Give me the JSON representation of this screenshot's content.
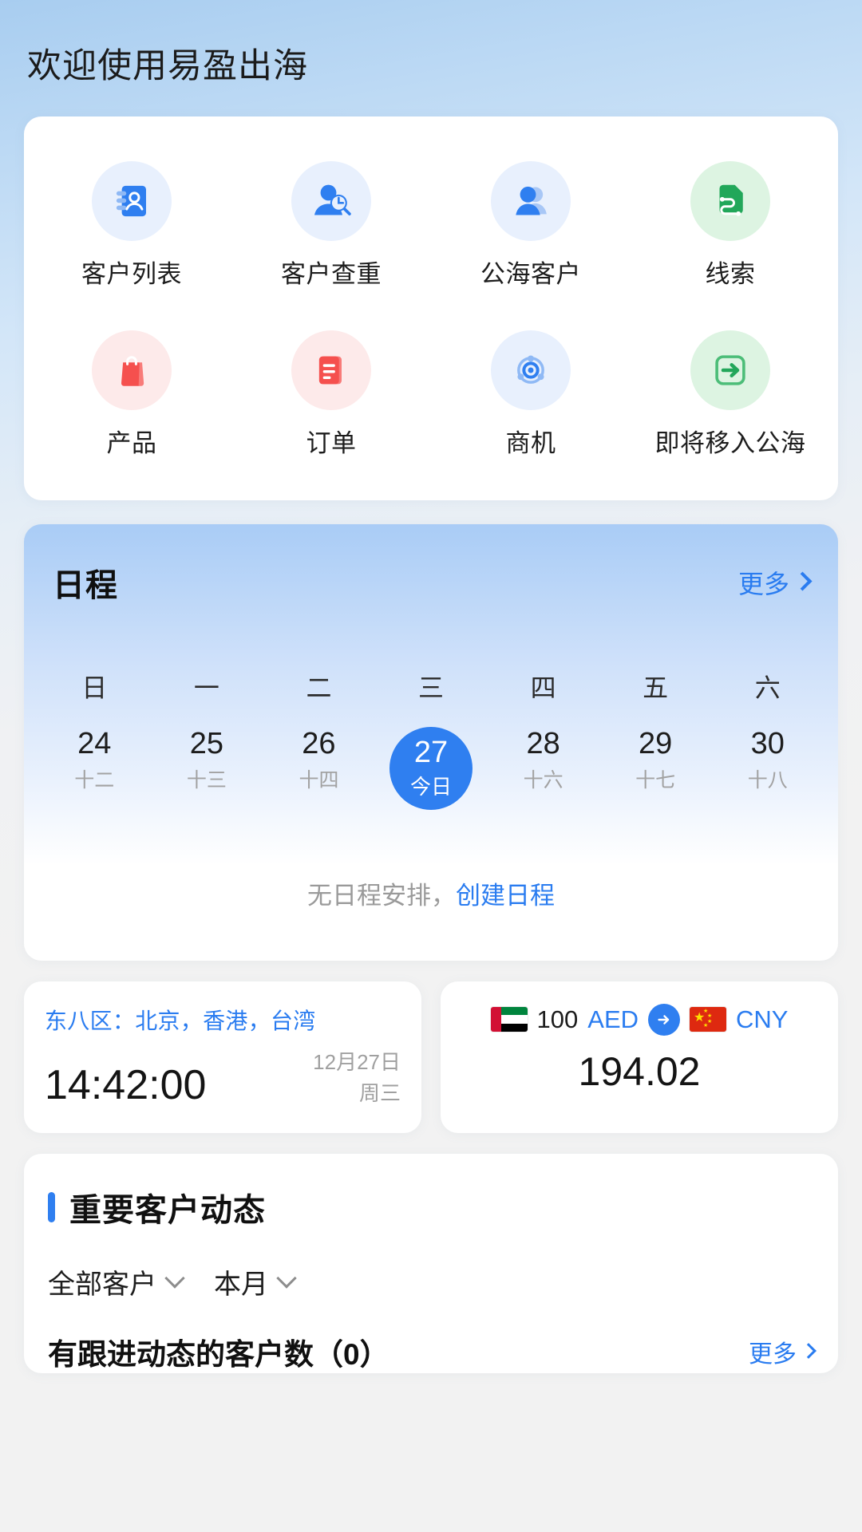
{
  "header": {
    "title": "欢迎使用易盈出海"
  },
  "quicknav": {
    "items": [
      {
        "label": "客户列表",
        "icon": "contact-book-icon",
        "tone": "blue"
      },
      {
        "label": "客户查重",
        "icon": "person-search-icon",
        "tone": "blue"
      },
      {
        "label": "公海客户",
        "icon": "people-group-icon",
        "tone": "blue"
      },
      {
        "label": "线索",
        "icon": "lead-route-icon",
        "tone": "green"
      },
      {
        "label": "产品",
        "icon": "shopping-bag-icon",
        "tone": "red"
      },
      {
        "label": "订单",
        "icon": "order-document-icon",
        "tone": "red"
      },
      {
        "label": "商机",
        "icon": "opportunity-target-icon",
        "tone": "blue"
      },
      {
        "label": "即将移入公海",
        "icon": "arrow-right-box-icon",
        "tone": "green"
      }
    ]
  },
  "schedule": {
    "title": "日程",
    "more_label": "更多",
    "weekdays": [
      "日",
      "一",
      "二",
      "三",
      "四",
      "五",
      "六"
    ],
    "days": [
      {
        "num": "24",
        "lunar": "十二",
        "today": false
      },
      {
        "num": "25",
        "lunar": "十三",
        "today": false
      },
      {
        "num": "26",
        "lunar": "十四",
        "today": false
      },
      {
        "num": "27",
        "lunar": "今日",
        "today": true
      },
      {
        "num": "28",
        "lunar": "十六",
        "today": false
      },
      {
        "num": "29",
        "lunar": "十七",
        "today": false
      },
      {
        "num": "30",
        "lunar": "十八",
        "today": false
      }
    ],
    "empty_text": "无日程安排，",
    "create_label": "创建日程"
  },
  "timezone_card": {
    "label": "东八区：北京，香港，台湾",
    "time": "14:42:00",
    "date": "12月27日",
    "weekday": "周三"
  },
  "currency_card": {
    "from_flag": "ae-flag-icon",
    "from_amount": "100",
    "from_currency": "AED",
    "arrow": "arrow-right-icon",
    "to_flag": "cn-flag-icon",
    "to_currency": "CNY",
    "rate": "194.02"
  },
  "customer_section": {
    "title": "重要客户动态",
    "filters": [
      {
        "label": "全部客户"
      },
      {
        "label": "本月"
      }
    ],
    "stat_label": "有跟进动态的客户数（0）",
    "stat_more": "更多"
  },
  "colors": {
    "accent": "#2f7ff0",
    "link": "#2a7cf0",
    "green": "#2aab5a",
    "red": "#f5504e"
  }
}
